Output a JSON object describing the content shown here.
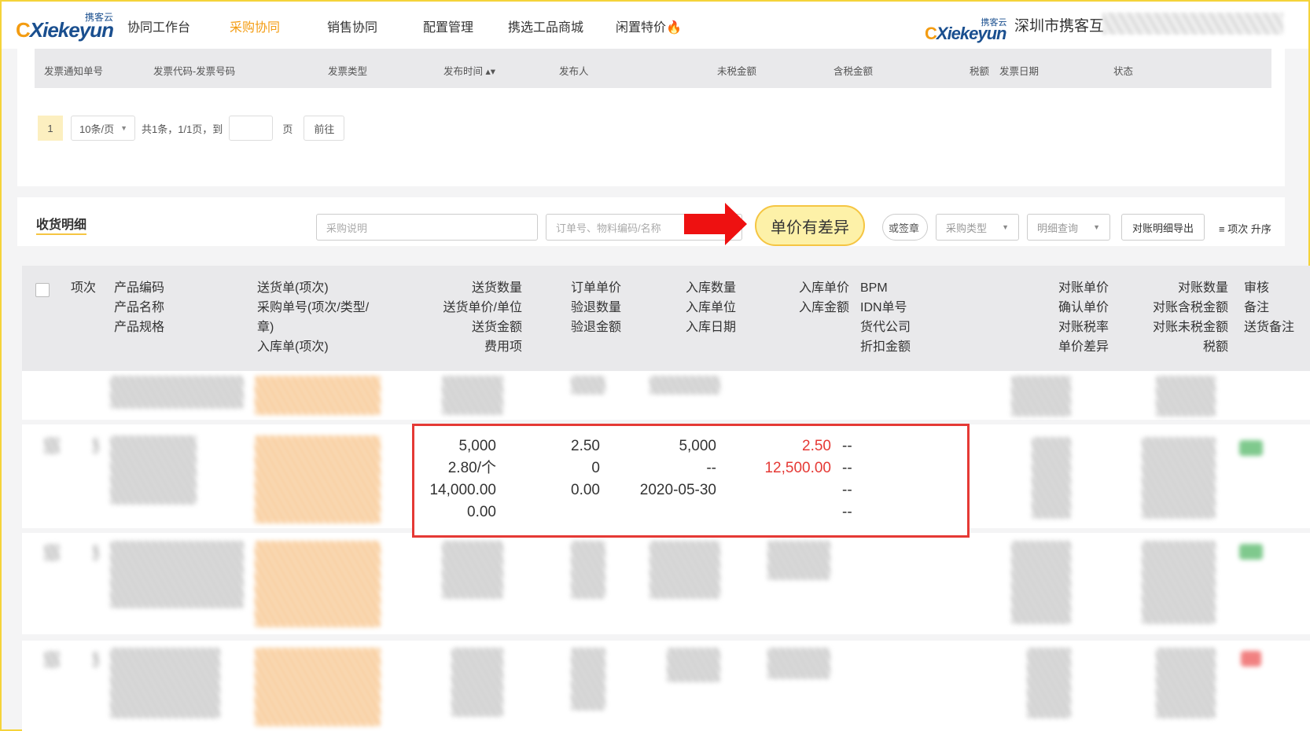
{
  "brand": {
    "logo_text": "Xiekeyun",
    "logo_sup": "携客云"
  },
  "nav": {
    "items": [
      {
        "label": "协同工作台"
      },
      {
        "label": "采购协同"
      },
      {
        "label": "销售协同"
      },
      {
        "label": "配置管理"
      },
      {
        "label": "携选工品商城"
      },
      {
        "label": "闲置特价"
      }
    ],
    "company": "深圳市携客互"
  },
  "invoice": {
    "columns": [
      "发票通知单号",
      "发票代码-发票号码",
      "发票类型",
      "发布时间",
      "发布人",
      "未税金额",
      "含税金额",
      "税额",
      "发票日期",
      "状态"
    ],
    "pager": {
      "page": "1",
      "size": "10条/页",
      "info": "共1条，1/1页，到",
      "unit": "页",
      "go": "前往"
    }
  },
  "receipt": {
    "title": "收货明细",
    "purchase_note_placeholder": "采购说明",
    "order_search_placeholder": "订单号、物料编码/名称",
    "highlight": "单价有差异",
    "pill_label": "或签章",
    "purchase_type": "采购类型",
    "detail_query": "明细查询",
    "export": "对账明细导出",
    "sort": "项次 升序"
  },
  "table": {
    "headers": {
      "idx": "项次",
      "product": [
        "产品编码",
        "产品名称",
        "产品规格"
      ],
      "delivery": [
        "送货单(项次)",
        "采购单号(项次/类型/",
        "章)",
        "入库单(项次)"
      ],
      "qty": [
        "送货数量",
        "送货单价/单位",
        "送货金额",
        "费用项"
      ],
      "order": [
        "订单单价",
        "验退数量",
        "验退金额"
      ],
      "stock": [
        "入库数量",
        "入库单位",
        "入库日期"
      ],
      "stock_price": [
        "入库单价",
        "入库金额"
      ],
      "bpm": [
        "BPM",
        "IDN单号",
        "货代公司",
        "折扣金额"
      ],
      "recon": [
        "对账单价",
        "确认单价",
        "对账税率",
        "单价差异"
      ],
      "recon_qty": [
        "对账数量",
        "对账含税金额",
        "对账未税金额",
        "税额"
      ],
      "audit": [
        "审核",
        "备注",
        "送货备注"
      ]
    },
    "focus_row": {
      "qty": [
        "5,000",
        "2.80/个",
        "14,000.00",
        "0.00"
      ],
      "order": [
        "2.50",
        "0",
        "0.00"
      ],
      "stock": [
        "5,000",
        "--",
        "2020-05-30"
      ],
      "stock_price": [
        "2.50",
        "12,500.00"
      ],
      "bpm": [
        "--",
        "--",
        "--",
        "--"
      ]
    }
  },
  "colors": {
    "accent": "#f39c12",
    "highlight_border": "#f5c542",
    "alert": "#e53935"
  }
}
